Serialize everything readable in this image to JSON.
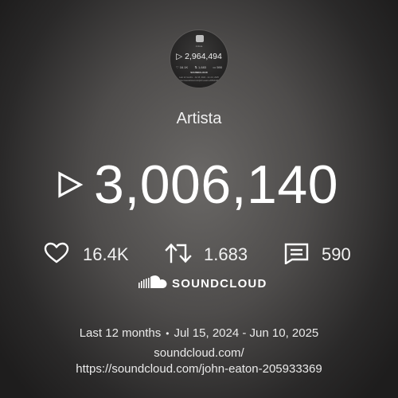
{
  "avatar": {
    "name": "Artista",
    "plays": "2,964,494",
    "likes": "16.1K",
    "reposts": "1,683",
    "comments": "590",
    "brand": "SOUNDCLOUD",
    "period": "Last 12 months · Jul 15, 2024 - Jun 10, 2025",
    "url": "https://soundcloud.com/john-eaton-205933369"
  },
  "artist_name": "Artista",
  "plays": "3,006,140",
  "stats": {
    "likes": "16.4K",
    "reposts": "1.683",
    "comments": "590"
  },
  "brand": "SOUNDCLOUD",
  "period": {
    "range_label": "Last 12 months",
    "dates": "Jul 15, 2024 - Jun 10, 2025"
  },
  "url_line1": "soundcloud.com/",
  "url_line2": "https://soundcloud.com/john-eaton-205933369",
  "icons": {
    "play": "play-outline-icon",
    "likes": "heart-outline-icon",
    "reposts": "repost-icon",
    "comments": "comment-icon",
    "brand": "soundcloud-logo-icon"
  },
  "colors": {
    "text": "#ffffff",
    "background_center": "#6a6866",
    "background_edge": "#1e1d1d"
  }
}
